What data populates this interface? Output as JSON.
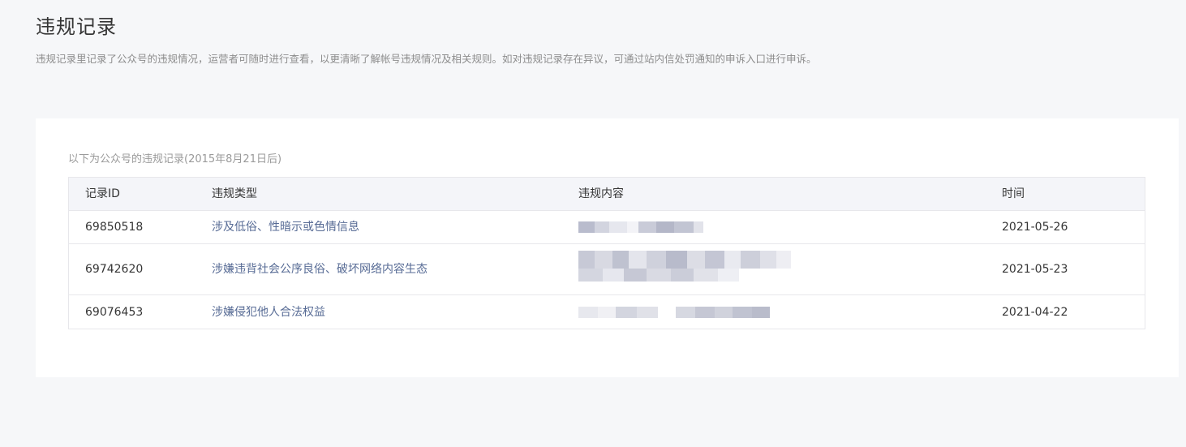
{
  "page": {
    "title": "违规记录",
    "description": "违规记录里记录了公众号的违规情况，运营者可随时进行查看，以更清晰了解帐号违规情况及相关规则。如对违规记录存在异议，可通过站内信处罚通知的申诉入口进行申诉。"
  },
  "records": {
    "caption": "以下为公众号的违规记录(2015年8月21日后)",
    "columns": {
      "id": "记录ID",
      "type": "违规类型",
      "content": "违规内容",
      "time": "时间"
    },
    "rows": [
      {
        "id": "69850518",
        "type": "涉及低俗、性暗示或色情信息",
        "time": "2021-05-26"
      },
      {
        "id": "69742620",
        "type": "涉嫌违背社会公序良俗、破坏网络内容生态",
        "time": "2021-05-23"
      },
      {
        "id": "69076453",
        "type": "涉嫌侵犯他人合法权益",
        "time": "2021-04-22"
      }
    ]
  },
  "colors": {
    "background": "#f6f7f9",
    "link": "#576b95",
    "header_bg": "#f4f5f9",
    "border": "#e7e7eb"
  }
}
